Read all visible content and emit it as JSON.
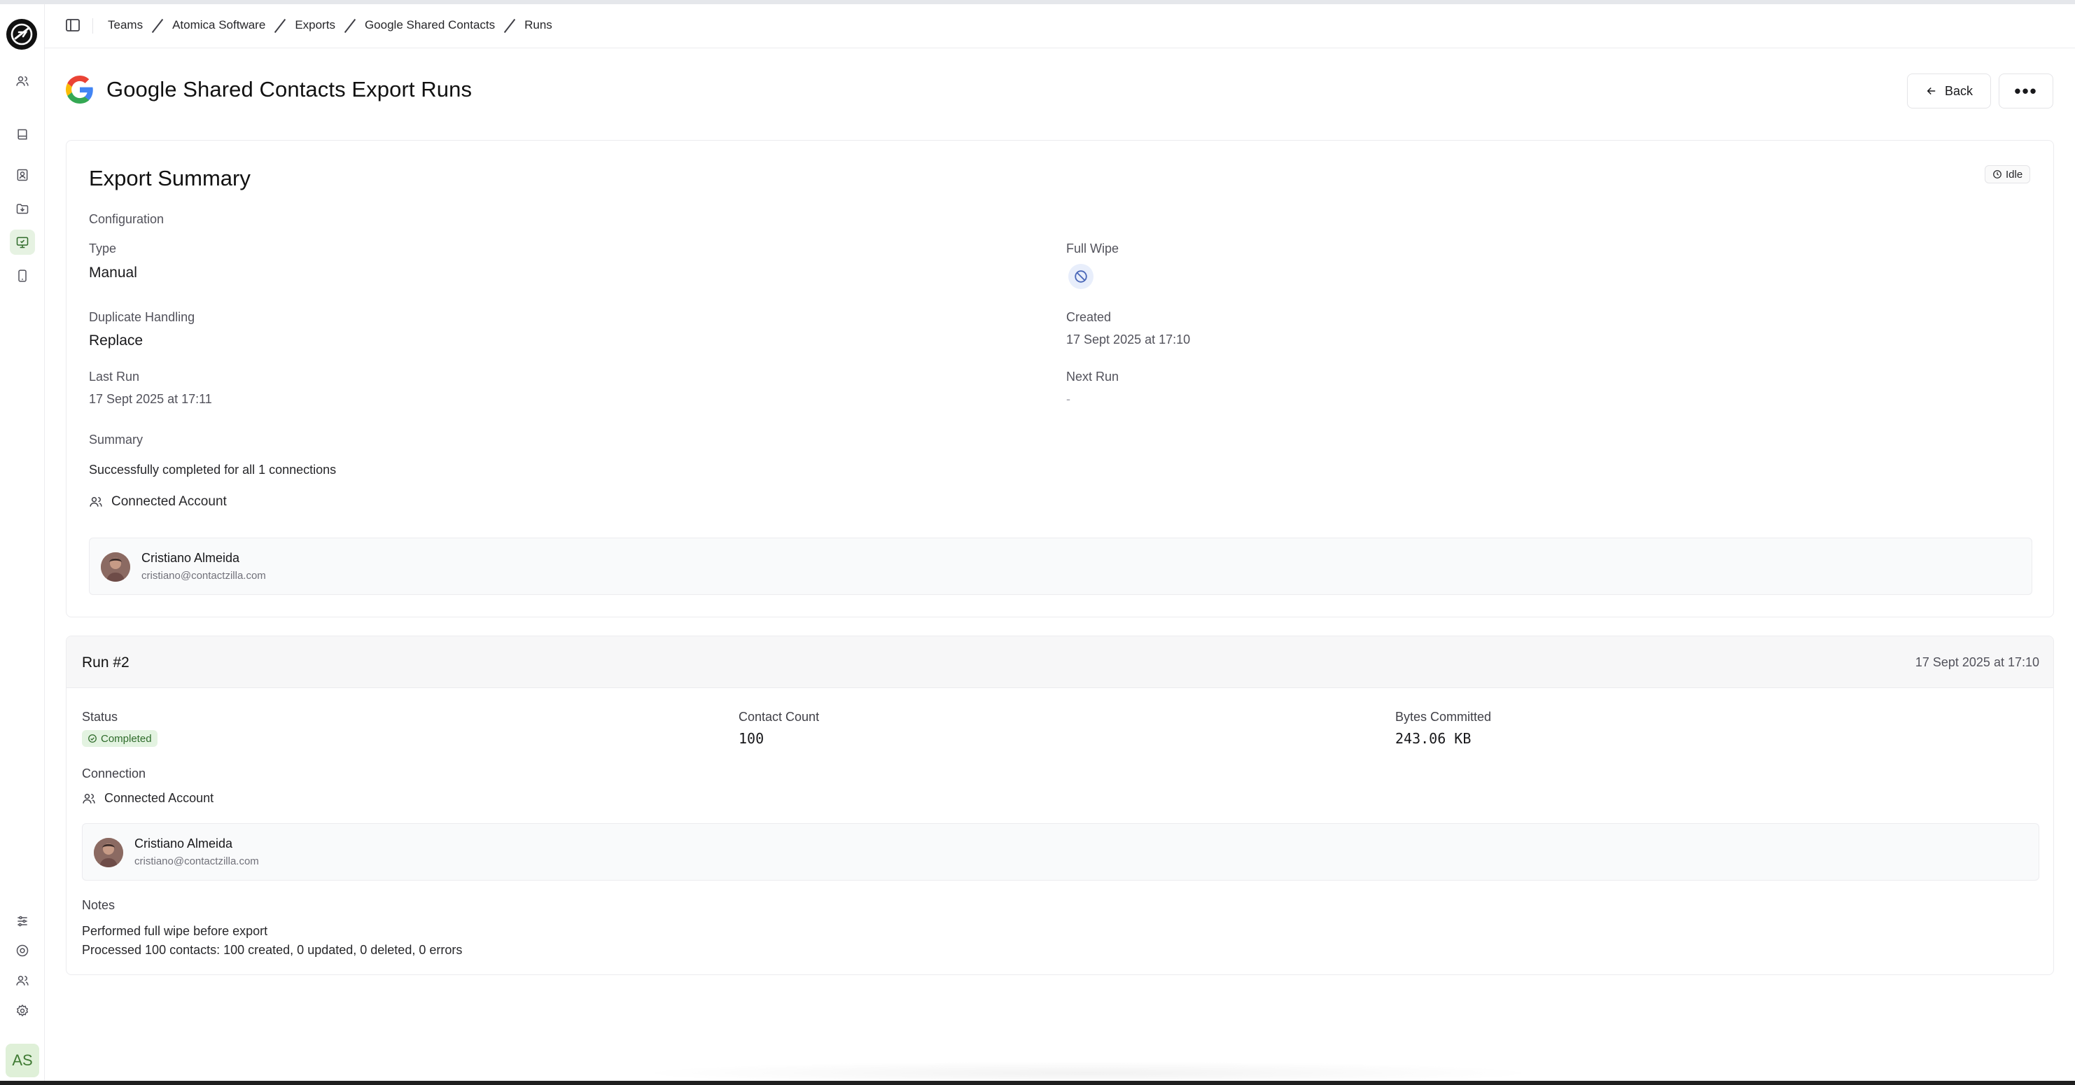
{
  "breadcrumb": [
    "Teams",
    "Atomica Software",
    "Exports",
    "Google Shared Contacts",
    "Runs"
  ],
  "page": {
    "title": "Google Shared Contacts Export Runs",
    "back_label": "Back",
    "more_label": "•••"
  },
  "summary": {
    "heading": "Export Summary",
    "status_badge": "Idle",
    "configuration_label": "Configuration",
    "type_label": "Type",
    "type_value": "Manual",
    "full_wipe_label": "Full Wipe",
    "duplicate_label": "Duplicate Handling",
    "duplicate_value": "Replace",
    "created_label": "Created",
    "created_value": "17 Sept 2025 at 17:10",
    "last_run_label": "Last Run",
    "last_run_value": "17 Sept 2025 at 17:11",
    "next_run_label": "Next Run",
    "next_run_value": "-",
    "summary_label": "Summary",
    "summary_value": "Successfully completed for all 1 connections",
    "connected_account_label": "Connected Account",
    "account": {
      "name": "Cristiano Almeida",
      "email": "cristiano@contactzilla.com"
    }
  },
  "run": {
    "title": "Run #2",
    "date": "17 Sept 2025 at 17:10",
    "status_label": "Status",
    "status_value": "Completed",
    "contact_count_label": "Contact Count",
    "contact_count_value": "100",
    "bytes_label": "Bytes Committed",
    "bytes_value": "243.06 KB",
    "connection_label": "Connection",
    "connected_account_label": "Connected Account",
    "account": {
      "name": "Cristiano Almeida",
      "email": "cristiano@contactzilla.com"
    },
    "notes_label": "Notes",
    "notes": [
      "Performed full wipe before export",
      "Processed 100 contacts: 100 created, 0 updated, 0 deleted, 0 errors"
    ]
  },
  "user": {
    "initials": "AS"
  },
  "colors": {
    "accent_green": "#2e6b2a",
    "active_nav_bg": "#e6f2e2",
    "wipe_icon": "#4a67b8"
  }
}
